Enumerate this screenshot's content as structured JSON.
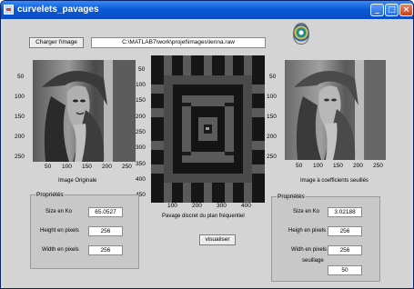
{
  "window": {
    "title": "curvelets_pavages",
    "minimize_icon": "minimize-icon",
    "maximize_icon": "maximize-icon",
    "close_icon": "close-icon"
  },
  "toolbar": {
    "load_button_label": "Charger l'image",
    "path_value": "C:\\MATLAB7\\work\\projet\\images\\lenna.raw"
  },
  "left_plot": {
    "caption": "Image Originale",
    "y_ticks": [
      "50",
      "100",
      "150",
      "200",
      "250"
    ],
    "x_ticks": [
      "50",
      "100",
      "150",
      "200",
      "250"
    ]
  },
  "center_plot": {
    "caption": "Pavage discret du plan fréquentiel",
    "y_ticks": [
      "50",
      "100",
      "150",
      "200",
      "250",
      "300",
      "350",
      "400",
      "450"
    ],
    "x_ticks": [
      "100",
      "200",
      "300",
      "400"
    ]
  },
  "right_plot": {
    "caption": "Image à coefficients seuillés",
    "y_ticks": [
      "50",
      "100",
      "150",
      "200",
      "250"
    ],
    "x_ticks": [
      "50",
      "100",
      "150",
      "200",
      "250"
    ]
  },
  "visualize_button_label": "visualiser",
  "left_panel": {
    "title": "Propriétés",
    "size_label": "Size en Ko",
    "size_value": "65.0527",
    "height_label": "Height en pixels",
    "height_value": "256",
    "width_label": "Width en pixels",
    "width_value": "256"
  },
  "right_panel": {
    "title": "Propriétés",
    "size_label": "Size en Ko",
    "size_value": "3.02188",
    "height_label": "Heigh en pixels",
    "height_value": "256",
    "width_label": "Widh en pixels",
    "width_value": "256",
    "threshold_label": "seuillage",
    "threshold_value": "50"
  },
  "colors": {
    "titlebar": "#0b5ad9",
    "client_bg": "#d4d4d4",
    "panel_bg": "#c8c8c8"
  }
}
